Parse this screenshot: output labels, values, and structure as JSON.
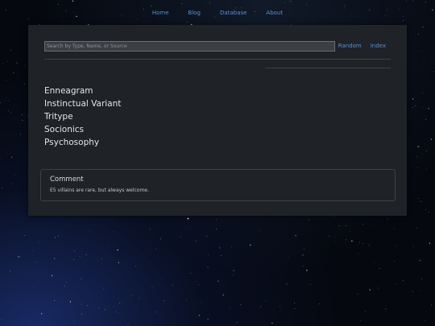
{
  "nav": {
    "items": [
      "Home",
      "Blog",
      "Database",
      "About"
    ]
  },
  "search": {
    "placeholder": "Search by Type, Name, or Source"
  },
  "toolbar": {
    "random_label": "Random",
    "index_label": "Index"
  },
  "types": [
    "Enneagram",
    "Instinctual Variant",
    "Tritype",
    "Socionics",
    "Psychosophy"
  ],
  "comment": {
    "title": "Comment",
    "text": "E5 villains are rare, but always welcome."
  },
  "colors": {
    "link": "#5b8fd1",
    "panel": "#1f2226",
    "background": "#05080f"
  }
}
